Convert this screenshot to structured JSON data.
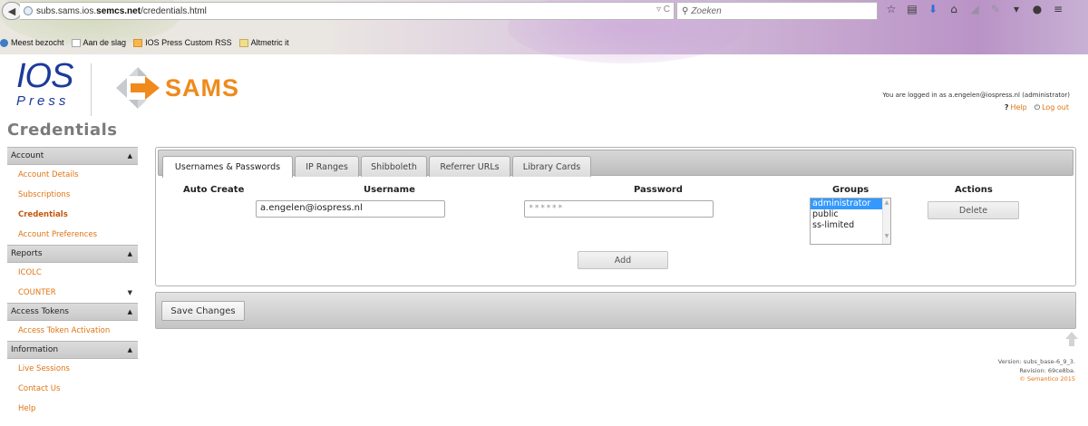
{
  "browser": {
    "url_prefix": "subs.sams.ios.",
    "url_bold": "semcs.net",
    "url_path": "/credentials.html",
    "url_right_icons": "▿ C",
    "search_placeholder": "Zoeken",
    "bookmarks": [
      {
        "label": "Meest bezocht",
        "icon": "star-bookmark-icon"
      },
      {
        "label": "Aan de slag",
        "icon": "page-bookmark-icon"
      },
      {
        "label": "IOS Press Custom RSS",
        "icon": "rss-icon"
      },
      {
        "label": "Altmetric it",
        "icon": "folder-icon"
      }
    ]
  },
  "header": {
    "logo_ios": "IOS",
    "logo_press": "Press",
    "logo_sams": "SAMS",
    "login_info": "You are logged in as a.engelen@iospress.nl (administrator)",
    "help_label": "Help",
    "logout_label": "Log out",
    "page_title": "Credentials"
  },
  "sidebar": {
    "sections": [
      {
        "title": "Account",
        "items": [
          "Account Details",
          "Subscriptions",
          "Credentials",
          "Account Preferences"
        ]
      },
      {
        "title": "Reports",
        "items": [
          "ICOLC",
          "COUNTER"
        ]
      },
      {
        "title": "Access Tokens",
        "items": [
          "Access Token Activation"
        ]
      },
      {
        "title": "Information",
        "items": [
          "Live Sessions",
          "Contact Us",
          "Help"
        ]
      }
    ],
    "active_item": "Credentials"
  },
  "tabs": [
    "Usernames & Passwords",
    "IP Ranges",
    "Shibboleth",
    "Referrer URLs",
    "Library Cards"
  ],
  "active_tab": "Usernames & Passwords",
  "form": {
    "col_auto_create": "Auto Create",
    "col_username": "Username",
    "col_password": "Password",
    "col_groups": "Groups",
    "col_actions": "Actions",
    "username_value": "a.engelen@iospress.nl",
    "password_value": "******",
    "groups": [
      "administrator",
      "public",
      "ss-limited"
    ],
    "selected_group": "administrator",
    "delete_label": "Delete",
    "add_label": "Add"
  },
  "save_label": "Save Changes",
  "footer": {
    "version": "Version: subs_base-6_9_3.",
    "revision": "Revision: 69ce8ba.",
    "copyright": "© Semantico 2015"
  },
  "colors": {
    "brand_orange": "#f08a1c",
    "link_orange": "#e07310",
    "ios_blue": "#1b3a9a",
    "selection_blue": "#3399ff"
  }
}
